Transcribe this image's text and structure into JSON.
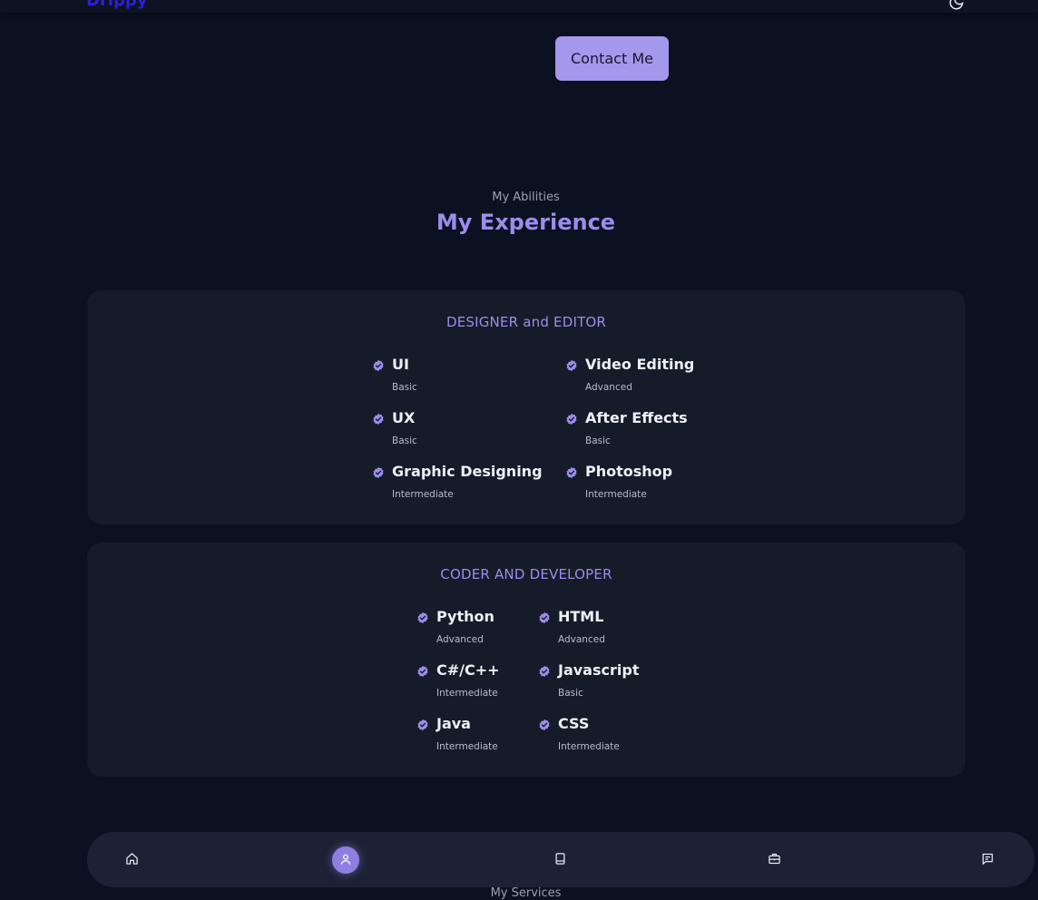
{
  "header": {
    "logo_text": "Drippy",
    "theme_toggle_icon": "moon-icon"
  },
  "hero": {
    "contact_button_label": "Contact Me"
  },
  "experience": {
    "subtitle": "My Abilities",
    "title": "My Experience",
    "cards": [
      {
        "title": "DESIGNER and EDITOR",
        "skills": [
          {
            "name": "UI",
            "level": "Basic"
          },
          {
            "name": "Video Editing",
            "level": "Advanced"
          },
          {
            "name": "UX",
            "level": "Basic"
          },
          {
            "name": "After Effects",
            "level": "Basic"
          },
          {
            "name": "Graphic Designing",
            "level": "Intermediate"
          },
          {
            "name": "Photoshop",
            "level": "Intermediate"
          }
        ]
      },
      {
        "title": "CODER AND DEVELOPER",
        "skills": [
          {
            "name": "Python",
            "level": "Advanced"
          },
          {
            "name": "HTML",
            "level": "Advanced"
          },
          {
            "name": "C#/C++",
            "level": "Intermediate"
          },
          {
            "name": "Javascript",
            "level": "Basic"
          },
          {
            "name": "Java",
            "level": "Intermediate"
          },
          {
            "name": "CSS",
            "level": "Intermediate"
          }
        ]
      }
    ]
  },
  "bottom_nav": {
    "items": [
      {
        "icon": "home-icon",
        "active": false
      },
      {
        "icon": "user-icon",
        "active": true
      },
      {
        "icon": "book-icon",
        "active": false
      },
      {
        "icon": "briefcase-icon",
        "active": false
      },
      {
        "icon": "message-icon",
        "active": false
      }
    ]
  },
  "next_section": {
    "subtitle": "My Services"
  },
  "colors": {
    "background": "#0b1120",
    "card": "#151b29",
    "accent": "#9d8ceb",
    "button": "#a497ec"
  }
}
